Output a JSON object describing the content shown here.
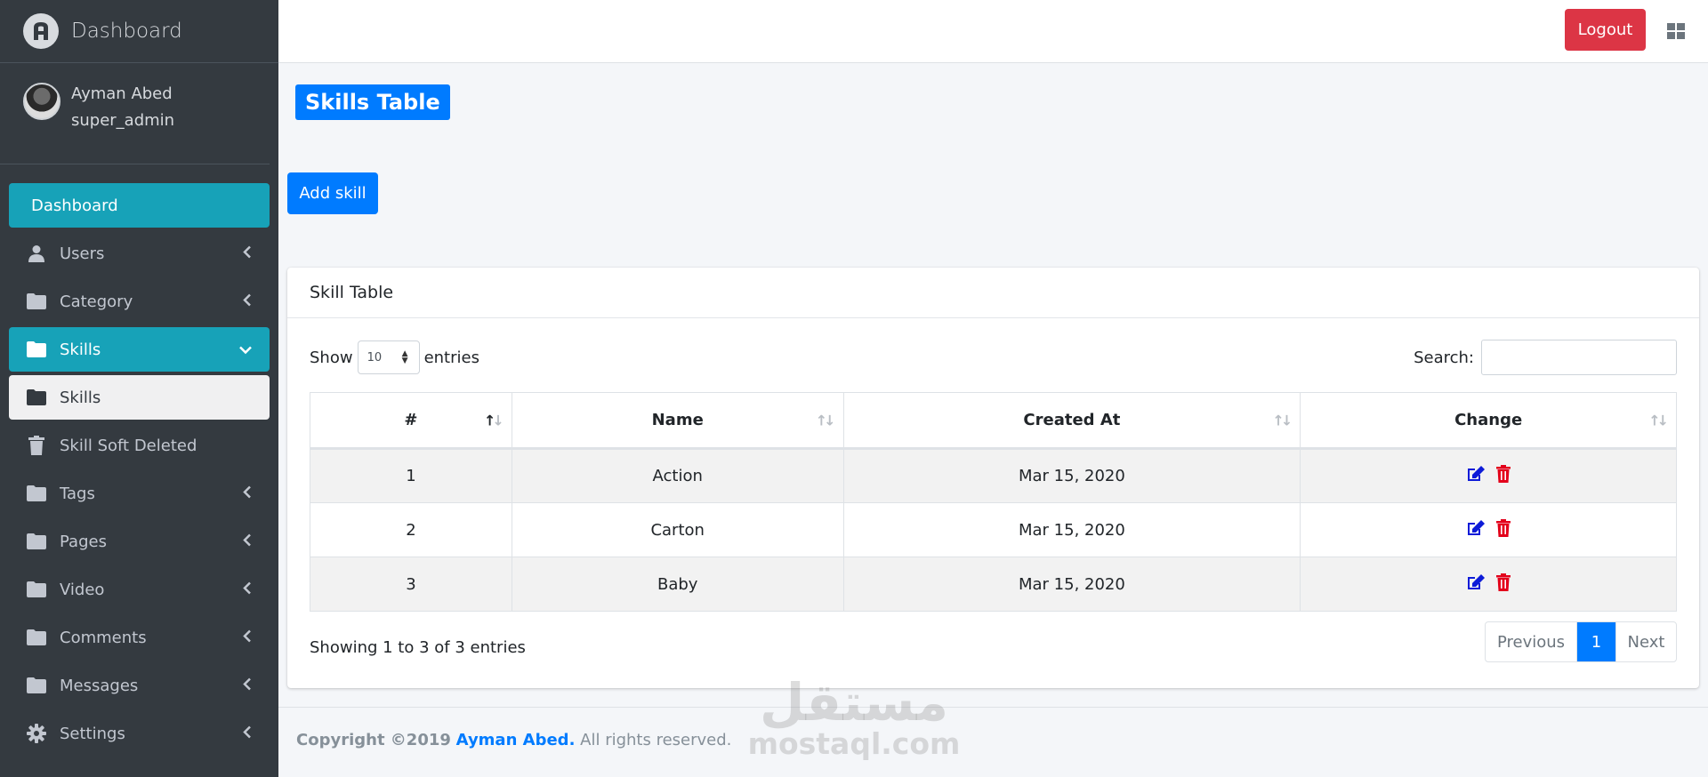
{
  "brand": {
    "title": "Dashboard"
  },
  "user": {
    "name": "Ayman Abed",
    "role": "super_admin"
  },
  "sidebar": {
    "items": [
      {
        "label": "Dashboard",
        "icon": "none",
        "state": "active"
      },
      {
        "label": "Users",
        "icon": "user-icon",
        "state": "collapsed"
      },
      {
        "label": "Category",
        "icon": "folder-icon",
        "state": "collapsed"
      },
      {
        "label": "Skills",
        "icon": "folder-icon",
        "state": "expanded"
      },
      {
        "label": "Skills",
        "icon": "folder-icon",
        "state": "sub-active"
      },
      {
        "label": "Skill Soft Deleted",
        "icon": "trash-icon",
        "state": "sub"
      },
      {
        "label": "Tags",
        "icon": "folder-icon",
        "state": "collapsed"
      },
      {
        "label": "Pages",
        "icon": "folder-icon",
        "state": "collapsed"
      },
      {
        "label": "Video",
        "icon": "folder-icon",
        "state": "collapsed"
      },
      {
        "label": "Comments",
        "icon": "folder-icon",
        "state": "collapsed"
      },
      {
        "label": "Messages",
        "icon": "folder-icon",
        "state": "collapsed"
      },
      {
        "label": "Settings",
        "icon": "gear-icon",
        "state": "collapsed"
      }
    ]
  },
  "header": {
    "logout_label": "Logout"
  },
  "page": {
    "title": "Skills Table",
    "add_label": "Add skill"
  },
  "card": {
    "title": "Skill Table",
    "show_label": "Show",
    "entries_value": "10",
    "entries_label": "entries",
    "search_label": "Search:",
    "columns": [
      "#",
      "Name",
      "Created At",
      "Change"
    ],
    "rows": [
      {
        "id": "1",
        "name": "Action",
        "created": "Mar 15, 2020"
      },
      {
        "id": "2",
        "name": "Carton",
        "created": "Mar 15, 2020"
      },
      {
        "id": "3",
        "name": "Baby",
        "created": "Mar 15, 2020"
      }
    ],
    "info": "Showing 1 to 3 of 3 entries",
    "pager": {
      "prev": "Previous",
      "current": "1",
      "next": "Next"
    }
  },
  "footer": {
    "copyright": "Copyright ©2019",
    "author": "Ayman Abed.",
    "rights": "All rights reserved."
  },
  "watermark": {
    "ar": "مستقل",
    "en": "mostaql.com"
  },
  "colors": {
    "primary": "#007bff",
    "danger": "#dc3545",
    "info": "#17a2b8",
    "sidebar": "#343a40",
    "edit": "#0d1bd8",
    "delete": "#e3001b"
  }
}
